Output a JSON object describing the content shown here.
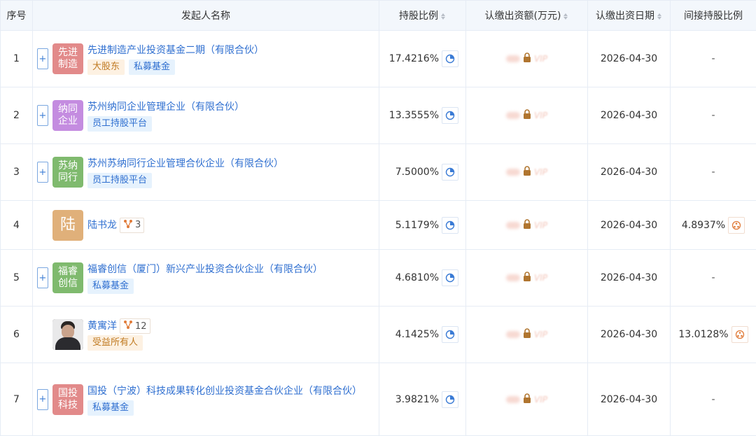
{
  "headers": {
    "idx": "序号",
    "name": "发起人名称",
    "pct": "持股比例",
    "amount": "认缴出资额(万元)",
    "date": "认缴出资日期",
    "indirect": "间接持股比例"
  },
  "rows": [
    {
      "idx": "1",
      "logo": "先进制造",
      "logo_color": "#e28a8a",
      "name": "先进制造产业投资基金二期（有限合伙）",
      "tags": [
        "大股东",
        "私募基金"
      ],
      "pct": "17.4216%",
      "amount_vip": "VIP",
      "date": "2026-04-30",
      "indirect": "-"
    },
    {
      "idx": "2",
      "logo": "纳同企业",
      "logo_color": "#c48ce0",
      "name": "苏州纳同企业管理企业（有限合伙）",
      "tags": [
        "员工持股平台"
      ],
      "pct": "13.3555%",
      "amount_vip": "VIP",
      "date": "2026-04-30",
      "indirect": "-"
    },
    {
      "idx": "3",
      "logo": "苏纳同行",
      "logo_color": "#7fba6e",
      "name": "苏州苏纳同行企业管理合伙企业（有限合伙）",
      "tags": [
        "员工持股平台"
      ],
      "pct": "7.5000%",
      "amount_vip": "VIP",
      "date": "2026-04-30",
      "indirect": "-"
    },
    {
      "idx": "4",
      "logo": "陆",
      "logo_color": "#e0b07a",
      "name": "陆书龙",
      "rel_count": "3",
      "tags": [],
      "pct": "5.1179%",
      "amount_vip": "VIP",
      "date": "2026-04-30",
      "indirect": "4.8937%"
    },
    {
      "idx": "5",
      "logo": "福睿创信",
      "logo_color": "#7fba6e",
      "name": "福睿创信（厦门）新兴产业投资合伙企业（有限合伙）",
      "tags": [
        "私募基金"
      ],
      "pct": "4.6810%",
      "amount_vip": "VIP",
      "date": "2026-04-30",
      "indirect": "-"
    },
    {
      "idx": "6",
      "logo": "",
      "name": "黄寓洋",
      "rel_count": "12",
      "tags": [
        "受益所有人"
      ],
      "pct": "4.1425%",
      "amount_vip": "VIP",
      "date": "2026-04-30",
      "indirect": "13.0128%"
    },
    {
      "idx": "7",
      "logo": "国投科技",
      "logo_color": "#e28a8a",
      "name": "国投（宁波）科技成果转化创业投资基金合伙企业（有限合伙）",
      "tags": [
        "私募基金"
      ],
      "pct": "3.9821%",
      "amount_vip": "VIP",
      "date": "2026-04-30",
      "indirect": "-"
    }
  ],
  "icons": {
    "expand": "plus-icon",
    "pie": "pie-chart-icon",
    "lock": "lock-icon",
    "relation": "relation-graph-icon",
    "indirect": "indirect-path-icon",
    "sort": "sort-icon"
  },
  "colors": {
    "link": "#2f6fd0",
    "header_bg": "#f3f7fc",
    "tag_orange_text": "#c07a22",
    "tag_blue_text": "#2f6fd0",
    "lock": "#b0752f"
  }
}
